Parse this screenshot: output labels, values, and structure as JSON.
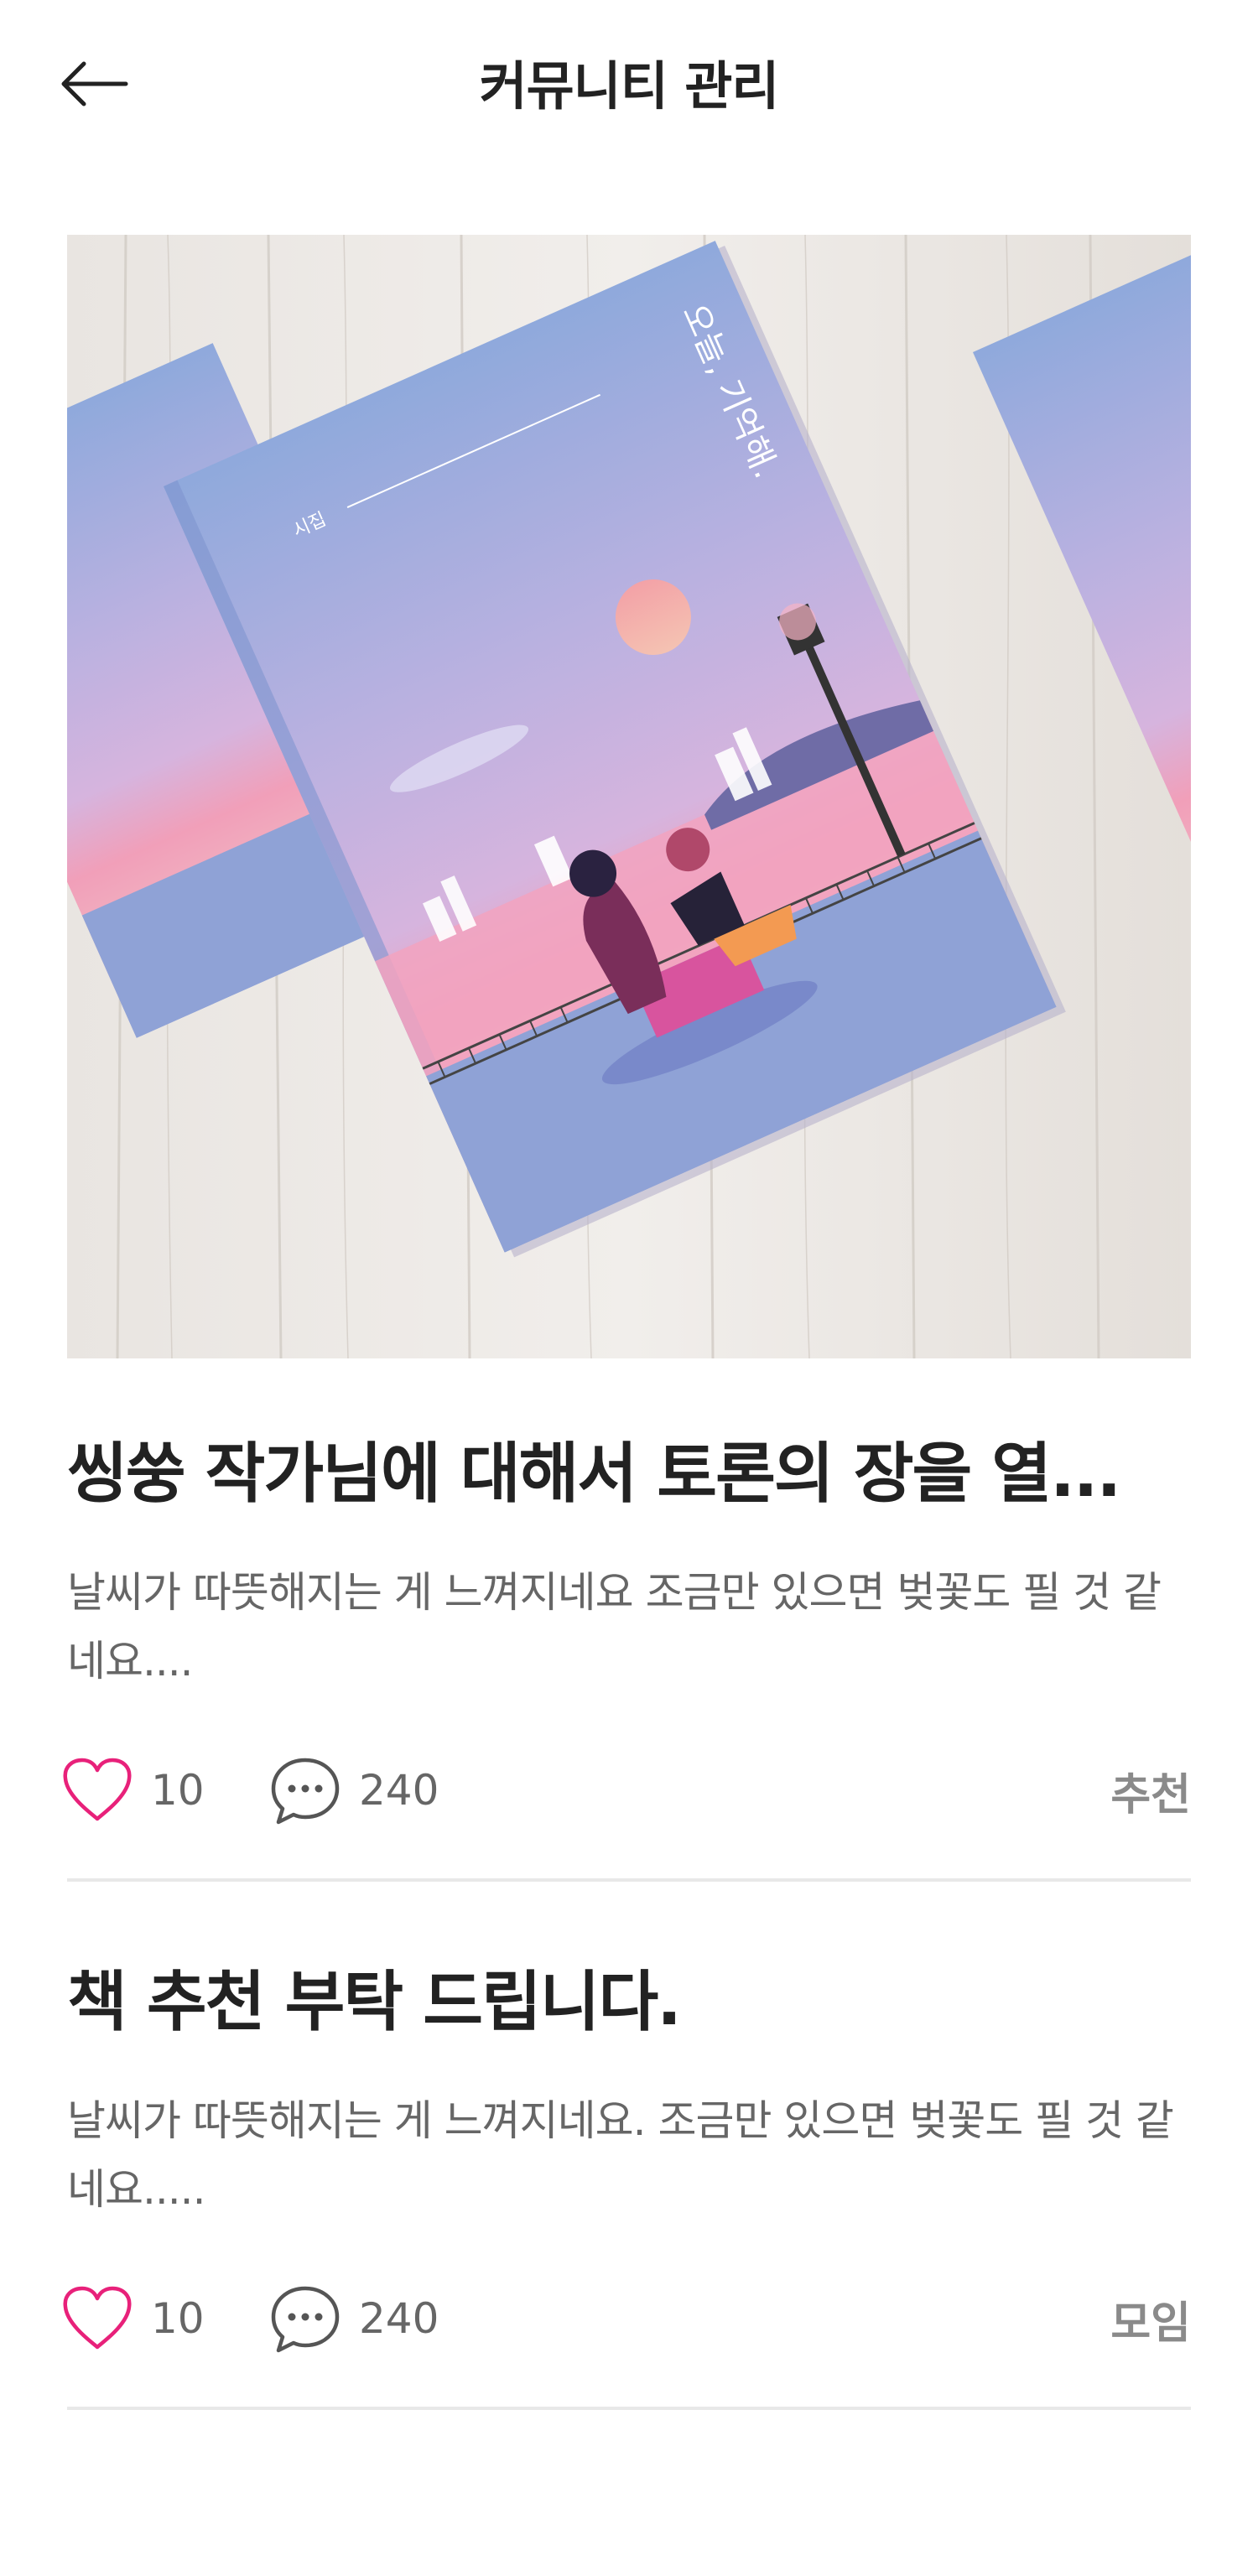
{
  "header": {
    "title": "커뮤니티 관리"
  },
  "posts": [
    {
      "title": "씽쑹 작가님에 대해서 토론의 장을 열...",
      "excerpt": "날씨가 따뜻해지는 게 느껴지네요 조금만 있으면 벚꽃도 필 것 같네요....",
      "likes": "10",
      "comments": "240",
      "category": "추천",
      "image": {
        "book_title": "오늘, 기억해.",
        "book_label": "시집"
      }
    },
    {
      "title": "책 추천 부탁 드립니다.",
      "excerpt": "날씨가 따뜻해지는 게 느껴지네요. 조금만 있으면 벚꽃도 필 것 같네요.....",
      "likes": "10",
      "comments": "240",
      "category": "모임"
    }
  ],
  "icons": {
    "back": "arrow-left-icon",
    "like": "heart-outline-icon",
    "comment": "speech-bubble-icon"
  },
  "colors": {
    "accent": "#e8217a",
    "title_text": "#222222",
    "body_text": "#666666",
    "category_text": "#8a8a8a",
    "divider": "#e8e8e8"
  }
}
